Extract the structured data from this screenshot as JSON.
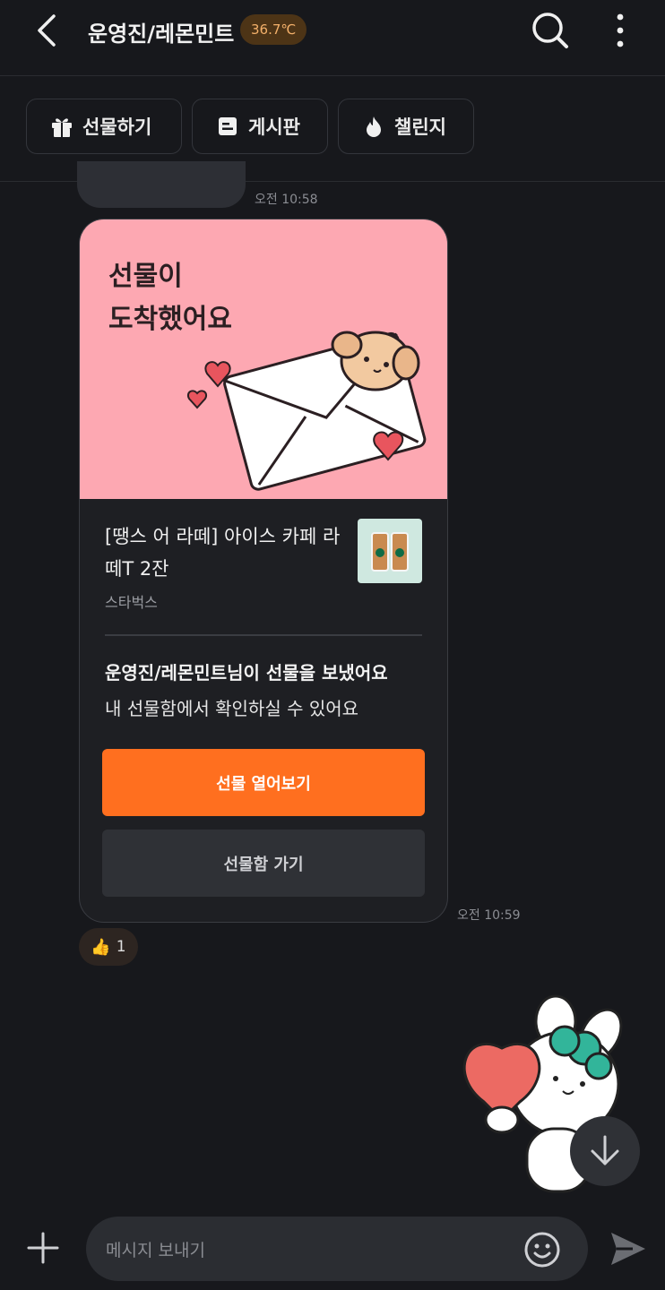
{
  "header": {
    "title": "운영진/레몬민트",
    "temperature": "36.7℃",
    "back_icon": "back-chevron-icon",
    "search_icon": "search-icon",
    "more_icon": "more-vertical-icon"
  },
  "chips": [
    {
      "label": "선물하기",
      "icon": "gift-icon"
    },
    {
      "label": "게시판",
      "icon": "board-icon"
    },
    {
      "label": "챌린지",
      "icon": "fire-icon"
    }
  ],
  "chat": {
    "prev_time": "오전 10:58",
    "card": {
      "banner_title": "선물이\n도착했어요",
      "product_name": "[땡스 어 라떼] 아이스 카페 라떼T 2잔",
      "product_brand": "스타벅스",
      "message_title": "운영진/레몬민트님이 선물을 보냈어요",
      "message_body": "내 선물함에서 확인하실 수 있어요",
      "open_button": "선물 열어보기",
      "box_button": "선물함 가기"
    },
    "card_time": "오전 10:59",
    "reaction": {
      "icon": "thumbs-up-icon",
      "count": "1"
    }
  },
  "composer": {
    "placeholder": "메시지 보내기",
    "plus_icon": "plus-icon",
    "emoji_icon": "emoji-icon",
    "send_icon": "send-icon"
  },
  "colors": {
    "background": "#17181c",
    "accent": "#ff6f1f",
    "banner": "#fda8b2",
    "temperature_bg": "#4d3416",
    "temperature_text": "#f3b06a"
  }
}
